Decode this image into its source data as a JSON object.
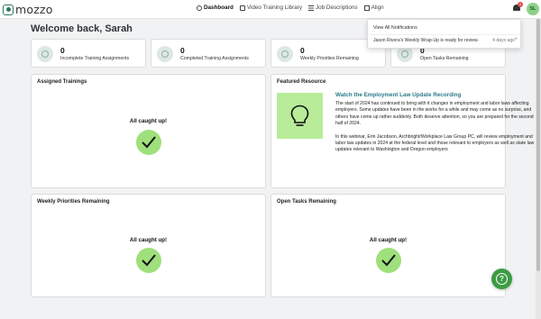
{
  "app": {
    "logo_text": "mozzo"
  },
  "nav": [
    {
      "label": "Dashboard",
      "icon": "clock-icon"
    },
    {
      "label": "Video Training Library",
      "icon": "play-icon"
    },
    {
      "label": "Job Descriptions",
      "icon": "grid-icon"
    },
    {
      "label": "Align",
      "icon": "document-icon"
    }
  ],
  "notifications": {
    "badge_count": "1",
    "view_all": "View All Notifications",
    "items": [
      {
        "text": "Jason Rivera's Weekly Wrap-Up is ready for review.",
        "time": "4 days ago"
      }
    ]
  },
  "user": {
    "initials": "SL"
  },
  "welcome": "Welcome back, Sarah",
  "stats": [
    {
      "value": "0",
      "label": "Incomplete Training Assignments"
    },
    {
      "value": "0",
      "label": "Completed Training Assignments"
    },
    {
      "value": "0",
      "label": "Weekly Priorities Remaining"
    },
    {
      "value": "0",
      "label": "Open Tasks Remaining"
    }
  ],
  "panels": {
    "assigned": {
      "title": "Assigned Trainings",
      "status": "All caught up!"
    },
    "featured": {
      "title": "Featured Resource",
      "resource_title": "Watch the Employment Law Update Recording",
      "paragraph1": "The start of 2024 has continued to bring with it changes in employment and labor laws affecting employers. Some updates have been in the works for a while and may come as no surprise, and others have come up rather suddenly. Both deserve attention, so you are prepared for the second half of 2024.",
      "paragraph2": "In this webinar, Erin Jacobson, Archbright/Workplace Law Group PC, will review employment and labor law updates in 2024 at the federal level and those relevant to employers as well as state law updates relevant to Washington and Oregon employers"
    },
    "weekly": {
      "title": "Weekly Priorities Remaining",
      "status": "All caught up!"
    },
    "tasks": {
      "title": "Open Tasks Remaining",
      "status": "All caught up!"
    }
  },
  "colors": {
    "accent_green": "#3d9b43",
    "check_green": "#9ee07b",
    "link_teal": "#2b7a8a"
  }
}
